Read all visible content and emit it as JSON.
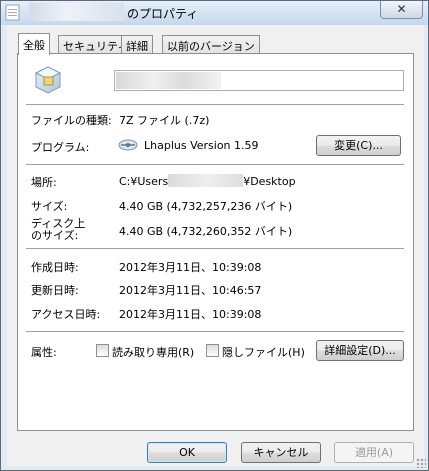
{
  "window": {
    "title_suffix": "のプロパティ",
    "close_label": "✕"
  },
  "tabs": [
    "全般",
    "セキュリティ",
    "詳細",
    "以前のバージョン"
  ],
  "general": {
    "file_type_label": "ファイルの種類:",
    "file_type_value": "7Z ファイル (.7z)",
    "program_label": "プログラム:",
    "program_value": "Lhaplus Version 1.59",
    "change_button": "変更(C)...",
    "location_label": "場所:",
    "location_prefix": "C:¥Users",
    "location_suffix": "¥Desktop",
    "size_label": "サイズ:",
    "size_value": "4.40 GB (4,732,257,236 バイト)",
    "disk_size_label_1": "ディスク上",
    "disk_size_label_2": "のサイズ:",
    "disk_size_value": "4.40 GB (4,732,260,352 バイト)",
    "created_label": "作成日時:",
    "created_value": "2012年3月11日、10:39:08",
    "modified_label": "更新日時:",
    "modified_value": "2012年3月11日、10:46:57",
    "accessed_label": "アクセス日時:",
    "accessed_value": "2012年3月11日、10:39:08",
    "attributes_label": "属性:",
    "readonly_label": "読み取り専用(R)",
    "hidden_label": "隠しファイル(H)",
    "advanced_button": "詳細設定(D)..."
  },
  "footer": {
    "ok": "OK",
    "cancel": "キャンセル",
    "apply": "適用(A)"
  }
}
